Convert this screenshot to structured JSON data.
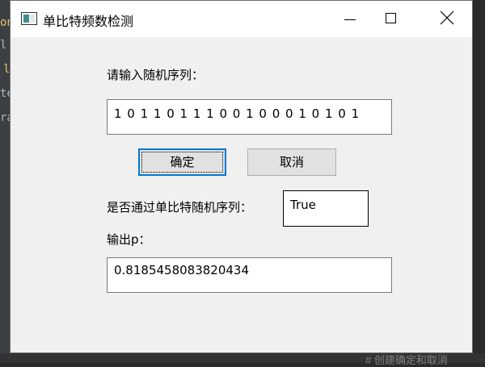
{
  "window": {
    "title": "单比特频数检测"
  },
  "form": {
    "input_label": "请输入随机序列：",
    "input_value": "1 0 1 1 0 1 1 1 0 0 1 0 0 0 1 0 1 0 1",
    "ok_label": "确定",
    "cancel_label": "取消",
    "pass_label": "是否通过单比特随机序列：",
    "pass_value": "True",
    "p_label": "输出p：",
    "p_value": "0.8185458083820434"
  },
  "background": {
    "fragments": [
      "on",
      "l v",
      "l",
      "te",
      "ra"
    ],
    "comment": "# 创建确定和取消"
  },
  "colors": {
    "focus_border": "#0078d7",
    "window_bg": "#f0f0f0"
  }
}
